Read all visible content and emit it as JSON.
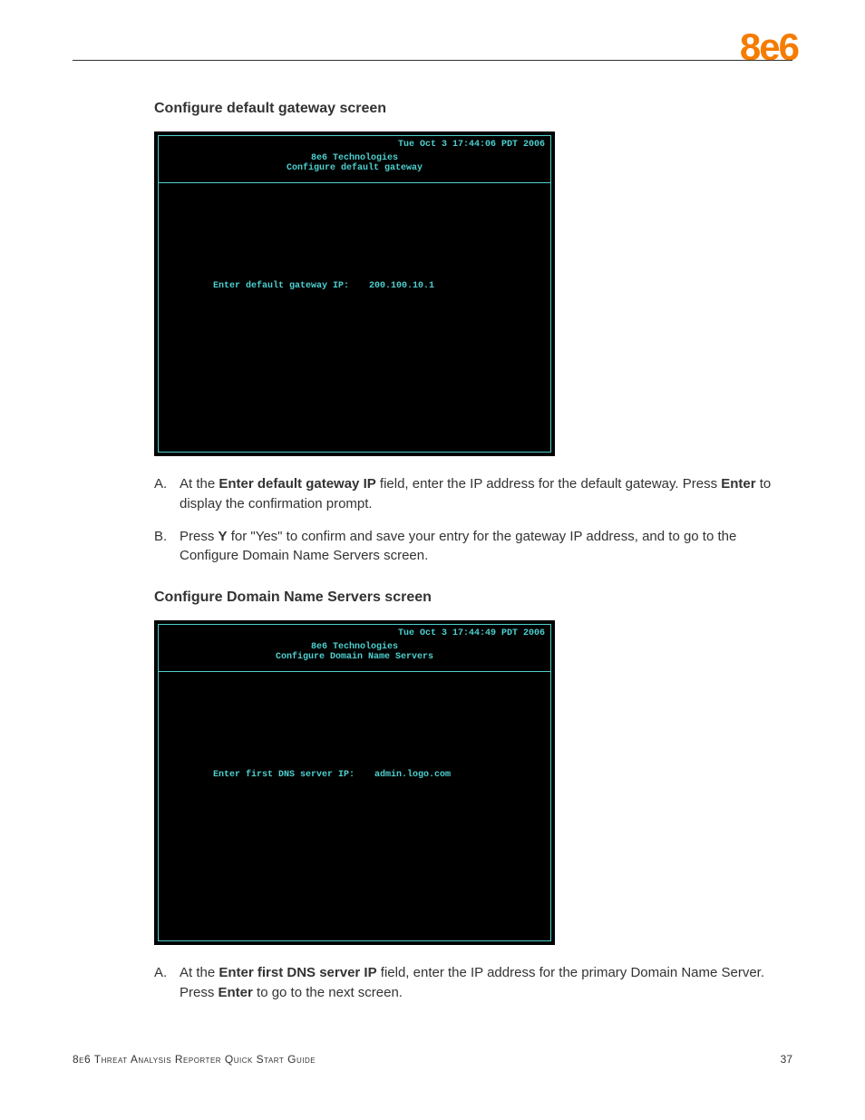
{
  "logo": "8e6",
  "sections": [
    {
      "title": "Configure default gateway screen",
      "terminal": {
        "date": "Tue Oct  3 17:44:06 PDT 2006",
        "company": "8e6 Technologies",
        "subtitle": "Configure default gateway",
        "prompt_label": "Enter default gateway IP:",
        "prompt_value": "200.100.10.1"
      },
      "steps": [
        {
          "letter": "A.",
          "parts": [
            {
              "t": "At the "
            },
            {
              "t": "Enter default gateway IP",
              "b": true
            },
            {
              "t": " field, enter the IP address for the default gateway. Press "
            },
            {
              "t": "Enter",
              "b": true
            },
            {
              "t": " to display the confirmation prompt."
            }
          ]
        },
        {
          "letter": "B.",
          "parts": [
            {
              "t": "Press "
            },
            {
              "t": "Y",
              "b": true
            },
            {
              "t": " for \"Yes\" to confirm and save your entry for the gateway IP address, and to go to the Configure Domain Name Servers screen."
            }
          ]
        }
      ]
    },
    {
      "title": "Configure Domain Name Servers screen",
      "terminal": {
        "date": "Tue Oct  3 17:44:49 PDT 2006",
        "company": "8e6 Technologies",
        "subtitle": "Configure Domain Name Servers",
        "prompt_label": "Enter first DNS server IP:",
        "prompt_value": "admin.logo.com"
      },
      "steps": [
        {
          "letter": "A.",
          "parts": [
            {
              "t": "At the "
            },
            {
              "t": "Enter first DNS server IP",
              "b": true
            },
            {
              "t": " field, enter the IP address for the primary Domain Name Server. Press "
            },
            {
              "t": "Enter",
              "b": true
            },
            {
              "t": " to go to the next screen."
            }
          ]
        }
      ]
    }
  ],
  "footer": {
    "guide": "8e6 Threat Analysis Reporter Quick Start Guide",
    "page": "37"
  }
}
